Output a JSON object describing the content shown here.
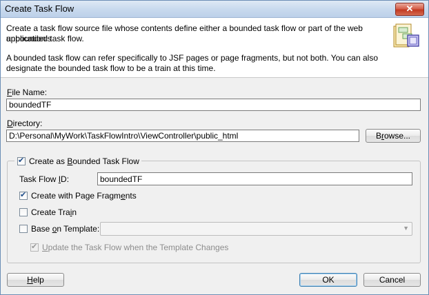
{
  "window": {
    "title": "Create Task Flow",
    "close_glyph": "✕"
  },
  "header": {
    "description_line1": "Create a task flow source file whose contents define either a bounded task flow or part of the web application's",
    "description_line2": "unbounded task flow.",
    "description_line3": "A bounded task flow can refer specifically to JSF pages or page fragments, but not both.  You can also",
    "description_line4": "designate the bounded task flow to be a train at this time.",
    "icon": "task-flow-wizard-icon"
  },
  "form": {
    "file_name": {
      "label_mnemonic": "F",
      "label_rest": "ile Name:",
      "value": "boundedTF"
    },
    "directory": {
      "label_mnemonic": "D",
      "label_rest": "irectory:",
      "value": "D:\\Personal\\MyWork\\TaskFlowIntro\\ViewController\\public_html"
    },
    "browse_button": {
      "pre": "B",
      "mnemonic": "r",
      "post": "owse..."
    },
    "bounded_group": {
      "checkbox_label_pre": "Create as ",
      "checkbox_label_mnemonic": "B",
      "checkbox_label_post": "ounded Task Flow",
      "checked": true,
      "task_flow_id": {
        "label_pre": "Task Flow ",
        "label_mnemonic": "I",
        "label_post": "D:",
        "value": "boundedTF"
      },
      "page_fragments": {
        "label_pre": "Create with Page Fragm",
        "label_mnemonic": "e",
        "label_post": "nts",
        "checked": true
      },
      "create_train": {
        "label_pre": "Create Tra",
        "label_mnemonic": "i",
        "label_post": "n",
        "checked": false
      },
      "base_on_template": {
        "label_pre": "Base ",
        "label_mnemonic": "o",
        "label_post": "n Template:",
        "checked": false,
        "selected": ""
      },
      "update_on_template_change": {
        "label_pre": "",
        "label_mnemonic": "U",
        "label_post": "pdate the Task Flow when the Template Changes",
        "checked": true,
        "enabled": false
      }
    }
  },
  "footer": {
    "help": {
      "mnemonic": "H",
      "rest": "elp"
    },
    "ok": "OK",
    "cancel": "Cancel"
  }
}
